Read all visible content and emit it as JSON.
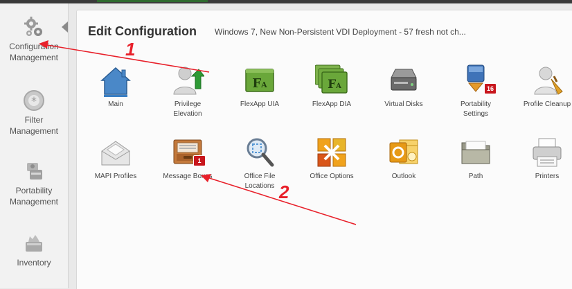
{
  "sidebar": {
    "items": [
      {
        "label": "Configuration\nManagement",
        "icon": "gears-icon"
      },
      {
        "label": "Filter\nManagement",
        "icon": "filter-icon"
      },
      {
        "label": "Portability\nManagement",
        "icon": "portability-icon"
      },
      {
        "label": "Inventory",
        "icon": "inventory-icon"
      }
    ]
  },
  "header": {
    "title": "Edit Configuration",
    "subtitle": "Windows 7, New Non-Persistent VDI Deployment - 57 fresh not ch..."
  },
  "tiles": [
    {
      "label": "Main",
      "icon": "house-icon"
    },
    {
      "label": "Privilege\nElevation",
      "icon": "user-upgrade-icon"
    },
    {
      "label": "FlexApp UIA",
      "icon": "flexapp-icon"
    },
    {
      "label": "FlexApp DIA",
      "icon": "flexapp-stack-icon"
    },
    {
      "label": "Virtual Disks",
      "icon": "hard-drive-icon"
    },
    {
      "label": "Portability\nSettings",
      "icon": "portability-settings-icon",
      "badge": "16"
    },
    {
      "label": "Profile Cleanup",
      "icon": "profile-cleanup-icon"
    },
    {
      "label": "MAPI Profiles",
      "icon": "envelope-icon"
    },
    {
      "label": "Message Boxes",
      "icon": "inbox-tray-icon",
      "badge": "1"
    },
    {
      "label": "Office File\nLocations",
      "icon": "magnifier-icon"
    },
    {
      "label": "Office Options",
      "icon": "office-logo-icon"
    },
    {
      "label": "Outlook",
      "icon": "outlook-icon"
    },
    {
      "label": "Path",
      "icon": "folder-icon"
    },
    {
      "label": "Printers",
      "icon": "printer-icon"
    }
  ],
  "annotations": [
    {
      "label": "1"
    },
    {
      "label": "2"
    }
  ],
  "colors": {
    "annotation_red": "#e8202a",
    "badge_red": "#c8161d",
    "house_blue": "#4a88c8",
    "flexapp_green": "#5a9a2e"
  }
}
